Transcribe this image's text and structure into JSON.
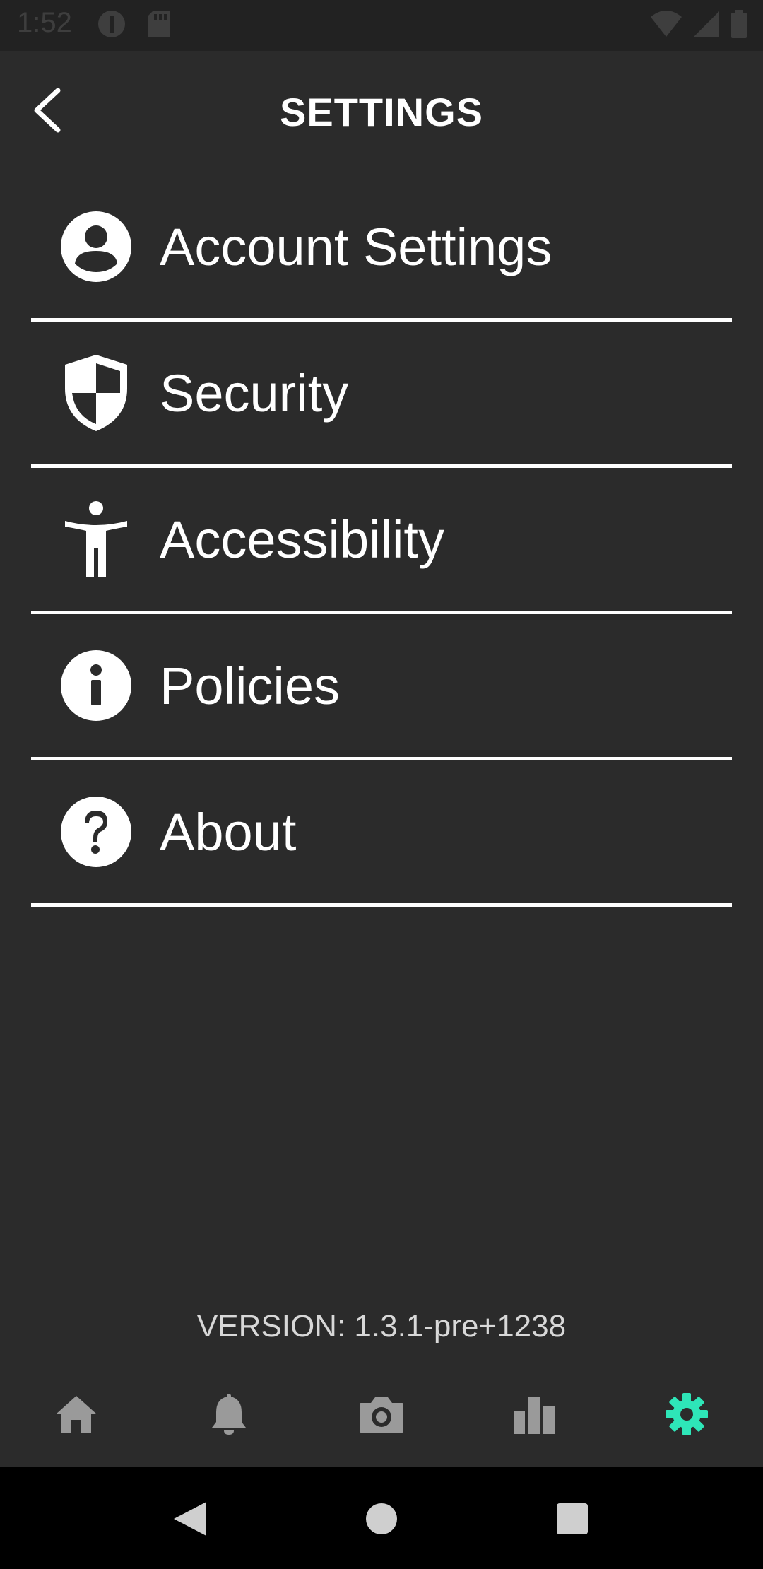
{
  "status_bar": {
    "time": "1:52",
    "icons": [
      "circle-app-icon",
      "sd-card-icon",
      "wifi-icon",
      "signal-icon",
      "battery-icon"
    ]
  },
  "header": {
    "title": "SETTINGS",
    "back_icon": "chevron-left-icon"
  },
  "settings": {
    "items": [
      {
        "label": "Account Settings",
        "icon": "account-circle-icon"
      },
      {
        "label": "Security",
        "icon": "shield-icon"
      },
      {
        "label": "Accessibility",
        "icon": "accessibility-icon"
      },
      {
        "label": "Policies",
        "icon": "info-icon"
      },
      {
        "label": "About",
        "icon": "help-icon"
      }
    ]
  },
  "footer": {
    "version": "VERSION: 1.3.1-pre+1238"
  },
  "bottom_nav": {
    "items": [
      {
        "name": "home",
        "icon": "home-icon",
        "active": false
      },
      {
        "name": "notifications",
        "icon": "bell-icon",
        "active": false
      },
      {
        "name": "camera",
        "icon": "camera-icon",
        "active": false
      },
      {
        "name": "stats",
        "icon": "bar-chart-icon",
        "active": false
      },
      {
        "name": "settings",
        "icon": "gear-icon",
        "active": true
      }
    ],
    "inactive_color": "#9a9a9a",
    "active_color": "#2ee6b8"
  },
  "system_nav": {
    "buttons": [
      "back-triangle-icon",
      "home-circle-icon",
      "recents-square-icon"
    ]
  },
  "colors": {
    "background": "#2b2b2b",
    "status_bar": "#222222",
    "divider": "#ffffff",
    "text": "#ffffff"
  }
}
